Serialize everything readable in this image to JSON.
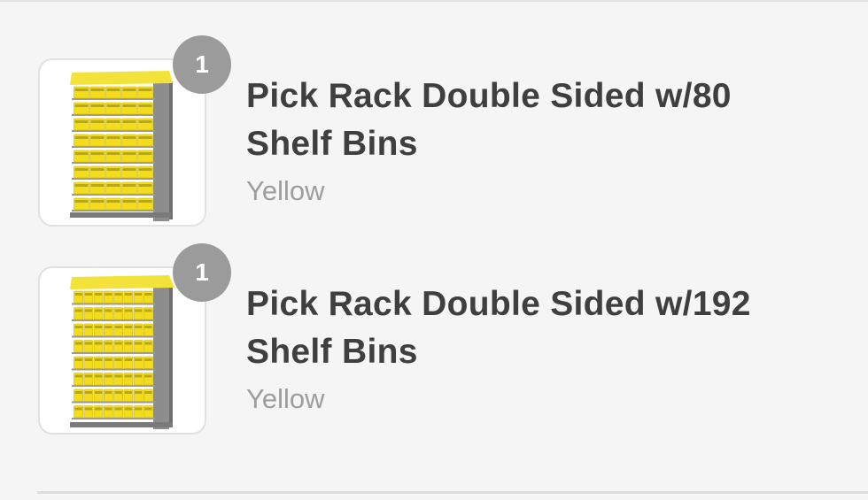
{
  "order_items": [
    {
      "quantity": "1",
      "title": "Pick Rack Double Sided w/80 Shelf Bins",
      "variant": "Yellow",
      "image_icon": "yellow-pick-rack-80-bins"
    },
    {
      "quantity": "1",
      "title": "Pick Rack Double Sided w/192 Shelf Bins",
      "variant": "Yellow",
      "image_icon": "yellow-pick-rack-192-bins"
    }
  ],
  "colors": {
    "background": "#f5f5f5",
    "badge": "#9b9b9b",
    "title_text": "#3f3f3f",
    "variant_text": "#9d9d9d",
    "bin_yellow": "#f2dc1c",
    "rack_gray": "#8d8d8d"
  }
}
